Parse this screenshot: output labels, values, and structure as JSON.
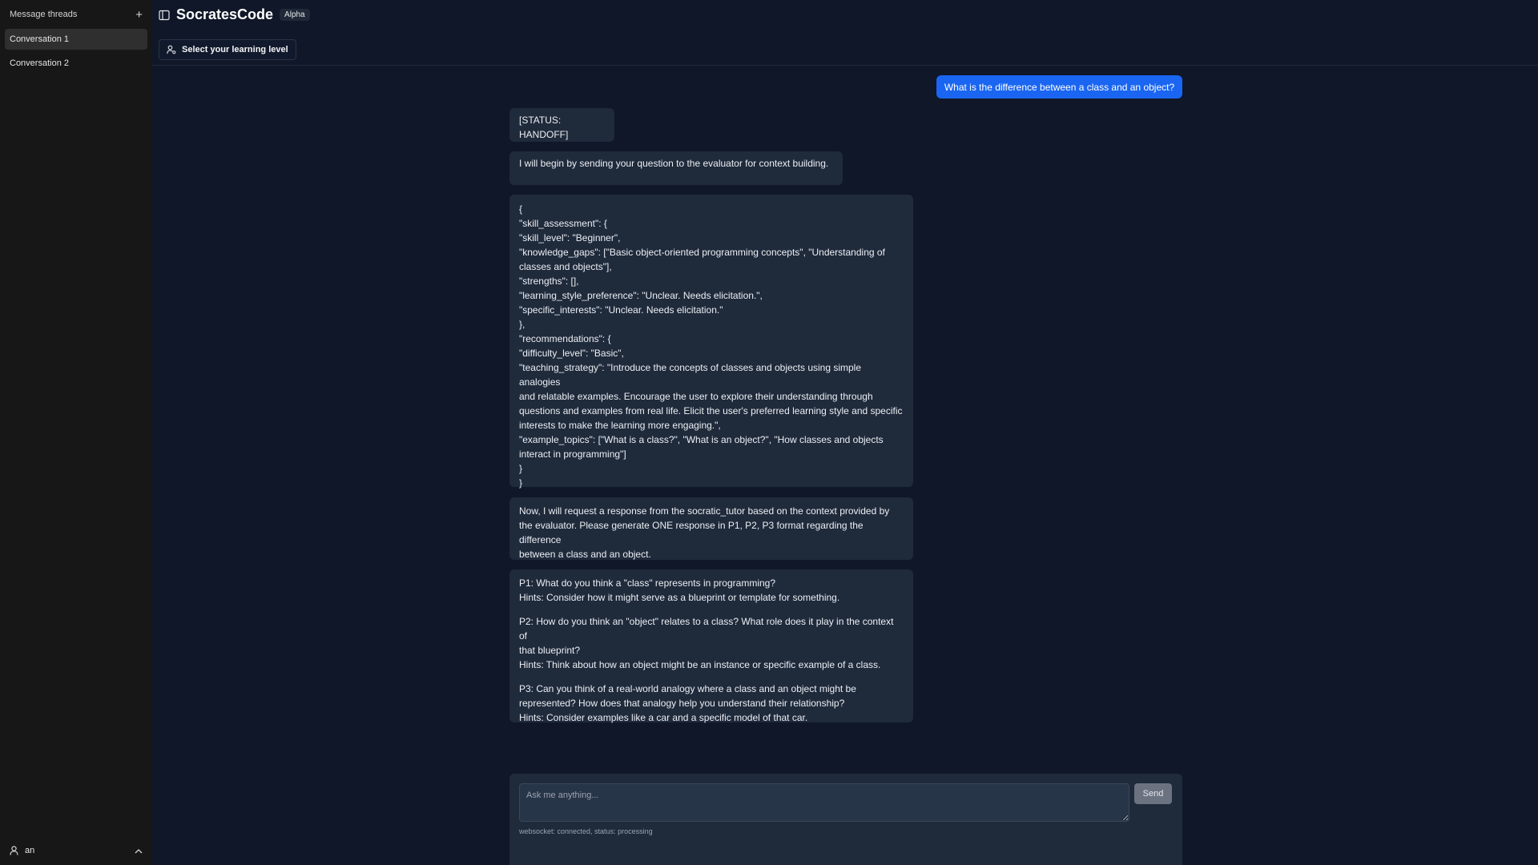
{
  "sidebar": {
    "title": "Message threads",
    "threads": [
      {
        "label": "Conversation 1",
        "active": true
      },
      {
        "label": "Conversation 2",
        "active": false
      }
    ],
    "user": "an"
  },
  "header": {
    "title": "SocratesCode",
    "badge": "Alpha",
    "level_button": "Select your learning level"
  },
  "messages": {
    "user_question": "What is the difference between a class and an object?",
    "status": "[STATUS: HANDOFF]",
    "intro": "I will begin by sending your question to the evaluator for context building.",
    "json_lines": [
      "{",
      "\"skill_assessment\": {",
      "\"skill_level\": \"Beginner\",",
      "\"knowledge_gaps\": [\"Basic object-oriented programming concepts\", \"Understanding of",
      "classes and objects\"],",
      "\"strengths\": [],",
      "\"learning_style_preference\": \"Unclear. Needs elicitation.\",",
      "\"specific_interests\": \"Unclear. Needs elicitation.\"",
      "},",
      "\"recommendations\": {",
      "\"difficulty_level\": \"Basic\",",
      "\"teaching_strategy\": \"Introduce the concepts of classes and objects using simple analogies",
      "and relatable examples. Encourage the user to explore their understanding through",
      "questions and examples from real life. Elicit the user's preferred learning style and specific",
      "interests to make the learning more engaging.\",",
      "\"example_topics\": [\"What is a class?\", \"What is an object?\", \"How classes and objects",
      "interact in programming\"]",
      "}",
      "}"
    ],
    "request_lines": [
      "Now, I will request a response from the socratic_tutor based on the context provided by",
      "the evaluator. Please generate ONE response in P1, P2, P3 format regarding the difference",
      "between a class and an object."
    ],
    "p1_lines": [
      "P1: What do you think a \"class\" represents in programming?",
      "Hints: Consider how it might serve as a blueprint or template for something."
    ],
    "p2_lines": [
      "P2: How do you think an \"object\" relates to a class? What role does it play in the context of",
      "that blueprint?",
      "Hints: Think about how an object might be an instance or specific example of a class."
    ],
    "p3_lines": [
      "P3: Can you think of a real-world analogy where a class and an object might be",
      "represented? How does that analogy help you understand their relationship?",
      "Hints: Consider examples like a car and a specific model of that car."
    ]
  },
  "input": {
    "placeholder": "Ask me anything...",
    "send_label": "Send",
    "status": "websocket: connected, status: processing"
  },
  "icons": {
    "new_thread": "plus-icon",
    "sidebar_toggle": "sidebar-toggle-icon",
    "level": "user-level-icon",
    "user": "user-icon",
    "chevron": "chevron-up-icon"
  },
  "colors": {
    "background": "#0f1728",
    "sidebar": "#171717",
    "user_bubble": "#1a66f2",
    "bot_bubble": "#1f2a3b"
  }
}
